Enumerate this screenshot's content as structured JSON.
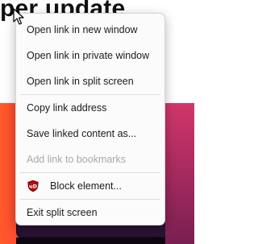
{
  "background": {
    "headline": "per update",
    "banner_colors": [
      "#ff5a2a",
      "#2a1038",
      "#d2366b"
    ]
  },
  "context_menu": {
    "items": [
      {
        "label": "Open link in new window",
        "enabled": true
      },
      {
        "label": "Open link in private window",
        "enabled": true
      },
      {
        "label": "Open link in split screen",
        "enabled": true
      },
      {
        "label": "Copy link address",
        "enabled": true
      },
      {
        "label": "Save linked content as...",
        "enabled": true
      },
      {
        "label": "Add link to bookmarks",
        "enabled": false
      },
      {
        "label": "Block element...",
        "enabled": true,
        "icon": "ublock-shield-icon"
      },
      {
        "label": "Exit split screen",
        "enabled": true
      }
    ]
  },
  "colors": {
    "menu_bg": "#fbfbfb",
    "text": "#1b1b1b",
    "disabled_text": "#a9a9a9",
    "ublock_red": "#800000"
  }
}
